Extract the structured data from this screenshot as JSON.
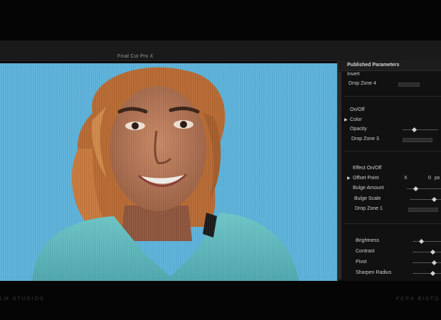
{
  "app": {
    "title": "Final Cut Pro X"
  },
  "inspector": {
    "title": "Published Parameters",
    "params": [
      {
        "id": "invert",
        "label": "Invert"
      },
      {
        "id": "drop-zone-4",
        "label": "Drop Zone 4"
      },
      {
        "id": "on-off",
        "label": "On/Off"
      },
      {
        "id": "color",
        "label": "Color"
      },
      {
        "id": "opacity",
        "label": "Opacity"
      },
      {
        "id": "drop-zone-3",
        "label": "Drop Zone 3"
      },
      {
        "id": "effect-on-off",
        "label": "Effect On/Off"
      },
      {
        "id": "offset-point",
        "label": "Offset Point"
      },
      {
        "id": "bulge-amount",
        "label": "Bulge Amount"
      },
      {
        "id": "bulge-scale",
        "label": "Bulge Scale"
      },
      {
        "id": "drop-zone-1",
        "label": "Drop Zone 1"
      },
      {
        "id": "brightness",
        "label": "Brightness"
      },
      {
        "id": "contrast",
        "label": "Contrast"
      },
      {
        "id": "pivot",
        "label": "Pivot"
      },
      {
        "id": "sharpen-radius",
        "label": "Sharpen Radius"
      }
    ],
    "offset_point_x_label": "X",
    "offset_point_value": "0",
    "offset_point_unit": "px"
  },
  "footer": {
    "left": "LM STUDIOS",
    "right": "FCPX BISTO"
  }
}
